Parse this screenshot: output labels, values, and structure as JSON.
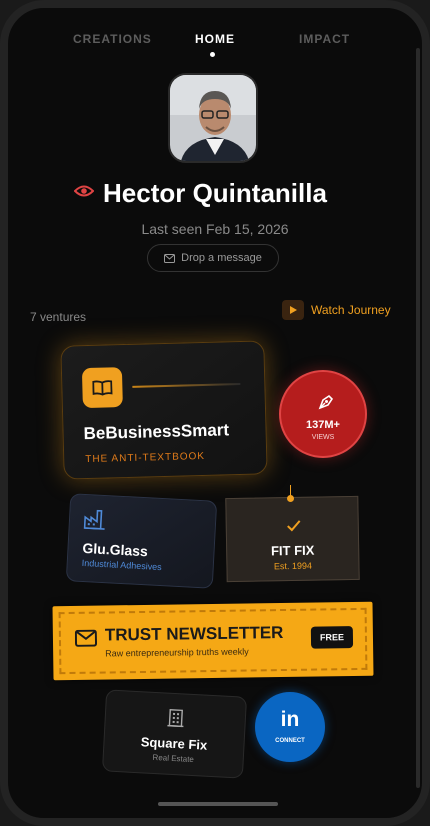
{
  "tabs": [
    {
      "label": "CREATIONS"
    },
    {
      "label": "HOME"
    },
    {
      "label": "IMPACT"
    }
  ],
  "profile": {
    "name": "Hector Quintanilla",
    "last_seen": "Last seen Feb 15, 2026",
    "message_label": "Drop a message"
  },
  "ventures": {
    "count_label": "7 ventures",
    "watch_label": "Watch Journey"
  },
  "cards": {
    "bbs": {
      "title": "BeBusinessSmart",
      "subtitle": "THE ANTI-TEXTBOOK"
    },
    "views": {
      "count": "137M+",
      "label": "VIEWS"
    },
    "glu": {
      "title": "Glu.Glass",
      "subtitle": "Industrial Adhesives"
    },
    "fit": {
      "title": "FIT FIX",
      "subtitle": "Est. 1994"
    },
    "newsletter": {
      "title": "TRUST NEWSLETTER",
      "subtitle": "Raw entrepreneurship truths weekly",
      "badge": "FREE"
    },
    "square": {
      "title": "Square Fix",
      "subtitle": "Real Estate"
    },
    "linkedin": {
      "logo": "in",
      "label": "CONNECT"
    }
  },
  "colors": {
    "accent": "#f0a020",
    "views_red": "#b51d1d",
    "linkedin_blue": "#0a66c2",
    "glu_blue": "#4f8ad8"
  },
  "icons": [
    "eye-icon",
    "mail-icon",
    "play-icon",
    "book-icon",
    "pen-icon",
    "factory-icon",
    "check-icon",
    "envelope-icon",
    "building-icon"
  ]
}
